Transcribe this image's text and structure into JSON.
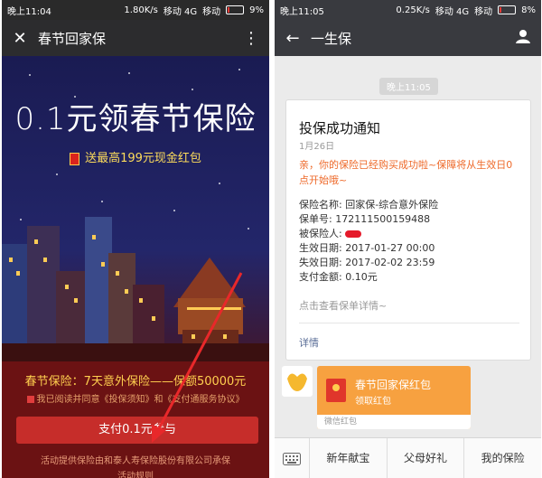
{
  "left": {
    "status": {
      "time": "晚上11:04",
      "speed": "1.80K/s",
      "carrier": "移动 4G",
      "carrier2": "移动",
      "battery": "9%"
    },
    "nav": {
      "close_icon": "close-icon",
      "title": "春节回家保",
      "more_icon": "more-vertical-icon"
    },
    "promo": {
      "headline": "0.1元领春节保险",
      "bonus": "送最高199元现金红包",
      "coverage": "春节保险：7天意外保险——保额50000元",
      "agree": "我已阅读并同意《投保须知》和《支付通服务协议》",
      "pay_button": "支付0.1元参与",
      "provider": "活动提供保险由和泰人寿保险股份有限公司承保",
      "rules": "活动规则"
    }
  },
  "right": {
    "status": {
      "time": "晚上11:05",
      "speed": "0.25K/s",
      "carrier": "移动 4G",
      "carrier2": "移动",
      "battery": "8%"
    },
    "nav": {
      "back_icon": "back-arrow-icon",
      "title": "一生保",
      "user_icon": "person-icon"
    },
    "chat": {
      "timestamp": "晚上11:05",
      "card": {
        "title": "投保成功通知",
        "date": "1月26日",
        "notice": "亲，你的保险已经购买成功啦~保障将从生效日0点开始哦~",
        "name_label": "保险名称: 回家保-综合意外保险",
        "policy_no": "保单号: 172111500159488",
        "insured": "被保险人: ",
        "start": "生效日期: 2017-01-27 00:00",
        "end": "失效日期: 2017-02-02 23:59",
        "amount": "支付金额: 0.10元",
        "view": "点击查看保单详情~",
        "detail": "详情"
      },
      "redpack": {
        "title": "春节回家保红包",
        "sub": "领取红包",
        "foot": "微信红包"
      }
    },
    "menu": [
      "新年献宝",
      "父母好礼",
      "我的保险"
    ]
  },
  "colors": {
    "accent_red": "#c62d2a",
    "link_blue": "#576b95",
    "warn_orange": "#ee6a2b",
    "redpack_orange": "#f7a140"
  }
}
